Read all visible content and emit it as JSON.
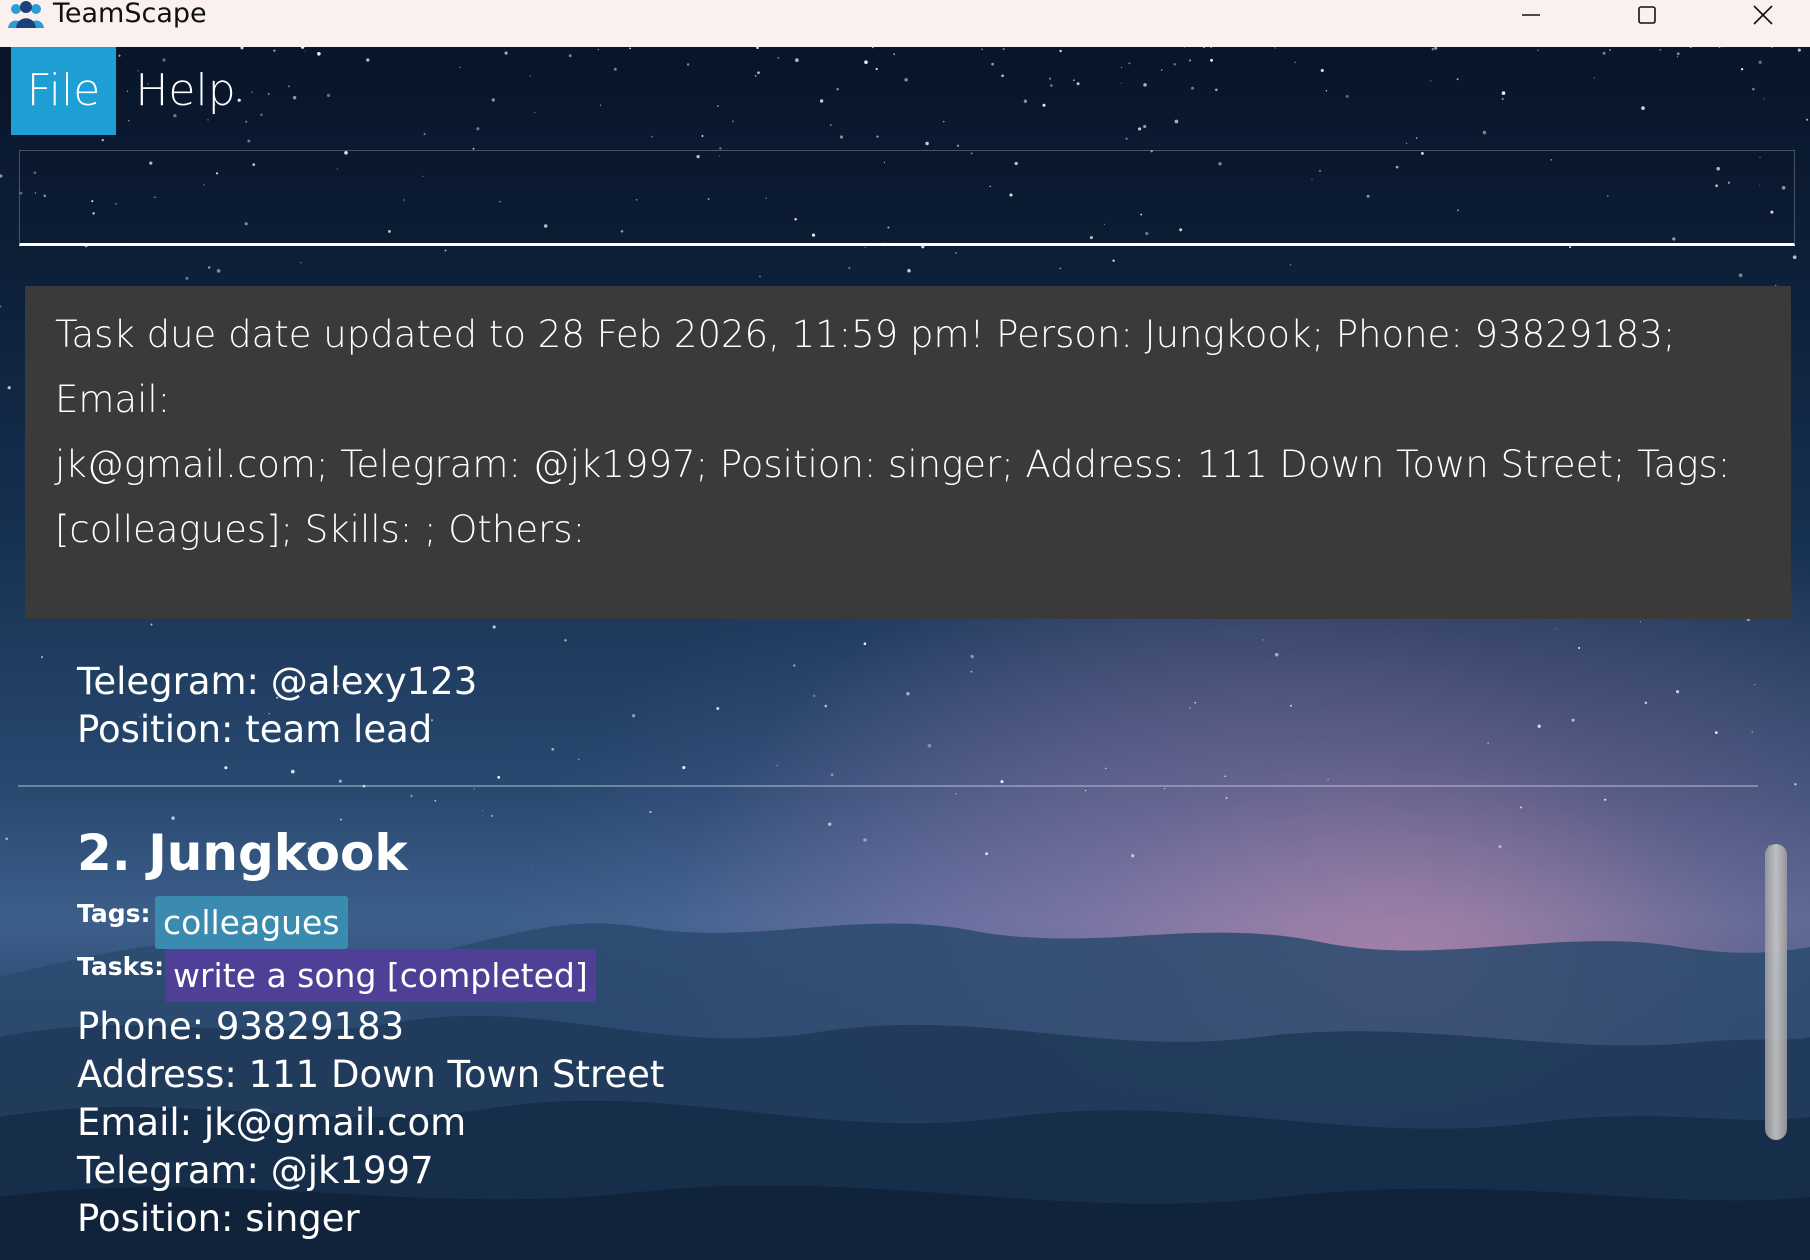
{
  "window": {
    "title": "TeamScape",
    "icons": {
      "app": "team-logo-icon",
      "minimize": "minimize-icon",
      "maximize": "maximize-icon",
      "close": "close-icon"
    }
  },
  "menu": {
    "file_label": "File",
    "help_label": "Help",
    "active_color": "#1e9fd3"
  },
  "command_box": {
    "value": "",
    "placeholder": ""
  },
  "result": {
    "line1": "Task due date updated to 28 Feb 2026, 11:59 pm! Person: Jungkook; Phone: 93829183; Email:",
    "line2": "jk@gmail.com; Telegram: @jk1997; Position: singer; Address: 111 Down Town Street; Tags:",
    "line3": "[colleagues]; Skills: ; Others:"
  },
  "previous_card": {
    "telegram": "Telegram: @alexy123",
    "position": "Position: team lead"
  },
  "person_card": {
    "name": "2. Jungkook",
    "tags_label": "Tags:",
    "tags": [
      "colleagues"
    ],
    "tasks_label": "Tasks:",
    "tasks": [
      "write a song [completed]"
    ],
    "phone": "Phone: 93829183",
    "address": "Address: 111 Down Town Street",
    "email": "Email: jk@gmail.com",
    "telegram": "Telegram: @jk1997",
    "position": "Position: singer"
  },
  "colors": {
    "tag_chip": "#3b8bb0",
    "task_chip": "#4f3f96",
    "result_bg": "#3a3a3a",
    "titlebar_bg": "#faf1ef"
  }
}
